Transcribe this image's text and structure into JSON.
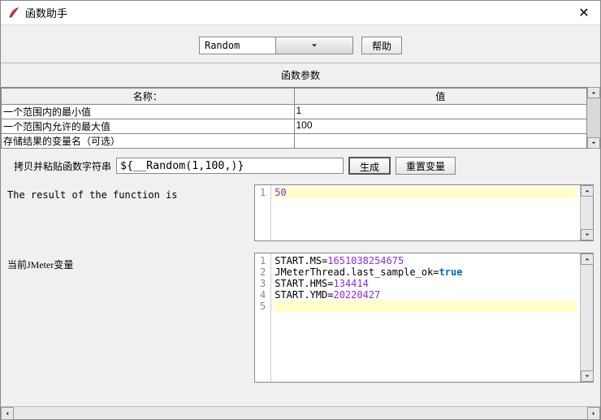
{
  "window": {
    "title": "函数助手"
  },
  "combo": {
    "selected": "Random"
  },
  "help_btn": "帮助",
  "params_title": "函数参数",
  "params_header": {
    "name": "名称：",
    "value": "值"
  },
  "params": [
    {
      "name": "一个范围内的最小值",
      "value": "1"
    },
    {
      "name": "一个范围内允许的最大值",
      "value": "100"
    },
    {
      "name": "存储结果的变量名（可选）",
      "value": ""
    }
  ],
  "funcstr": {
    "label": "拷贝并粘贴函数字符串",
    "value": "${__Random(1,100,)}"
  },
  "generate_btn": "生成",
  "reset_btn": "重置变量",
  "result_label": "The result of the function is ",
  "result_value": "50",
  "vars_label": "当前JMeter变量",
  "vars": [
    {
      "k": "START.MS",
      "v": "1651038254675"
    },
    {
      "k": "JMeterThread.last_sample_ok",
      "v": "true",
      "kw": true
    },
    {
      "k": "START.HMS",
      "v": "134414"
    },
    {
      "k": "START.YMD",
      "v": "20220427"
    }
  ]
}
